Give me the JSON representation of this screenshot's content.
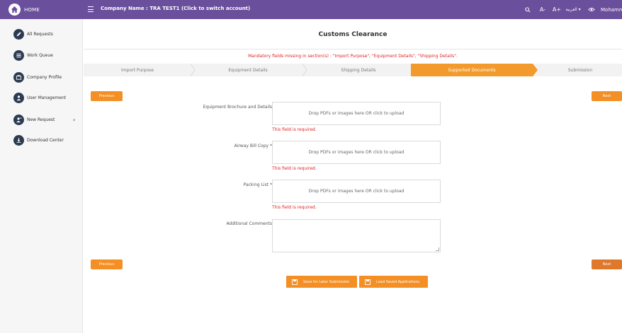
{
  "header": {
    "home_label": "HOME",
    "company": "Company Name : TRA TEST1 (Click to switch account)",
    "font_decrease": "A-",
    "font_increase": "A+",
    "language": "العربية ▾",
    "user": "Mohamm"
  },
  "sidebar": {
    "items": [
      {
        "label": "All Requests",
        "icon": "pen-icon"
      },
      {
        "label": "Work Queue",
        "icon": "queue-icon"
      },
      {
        "label": "Company Profile",
        "icon": "briefcase-icon"
      },
      {
        "label": "User Management",
        "icon": "users-icon"
      },
      {
        "label": "New Request",
        "icon": "user-plus-icon",
        "chevron": "›"
      },
      {
        "label": "Download Center",
        "icon": "download-icon"
      }
    ]
  },
  "page": {
    "title": "Customs Clearance",
    "error_banner": "Mandatory fields missing in section(s) : \"Import Purpose\", \"Equipment Details\", \"Shipping Details\"."
  },
  "steps": [
    {
      "label": "Import Purpose",
      "active": false
    },
    {
      "label": "Equipment Details",
      "active": false
    },
    {
      "label": "Shipping Details",
      "active": false
    },
    {
      "label": "Supported Documents",
      "active": true
    },
    {
      "label": "Submission",
      "active": false
    }
  ],
  "buttons": {
    "previous": "Previous",
    "next": "Next",
    "save_later": "Save for Later Submission",
    "load_saved": "Load Saved Applications"
  },
  "fields": {
    "equipment": {
      "label": "Equipment Brochure and Details",
      "dropzone": "Drop PDFs or images here OR click to upload",
      "error": "This field is required."
    },
    "airway": {
      "label": "Airway Bill Copy *",
      "dropzone": "Drop PDFs or images here OR click to upload",
      "error": "This field is required."
    },
    "packing": {
      "label": "Packing List *",
      "dropzone": "Drop PDFs or images here OR click to upload",
      "error": "This field is required."
    },
    "comments": {
      "label": "Additional Comments"
    }
  },
  "colors": {
    "header_bg": "#6a4f9c",
    "accent": "#f39a2c",
    "error": "#e02424",
    "icon_bg": "#2d3b52"
  }
}
